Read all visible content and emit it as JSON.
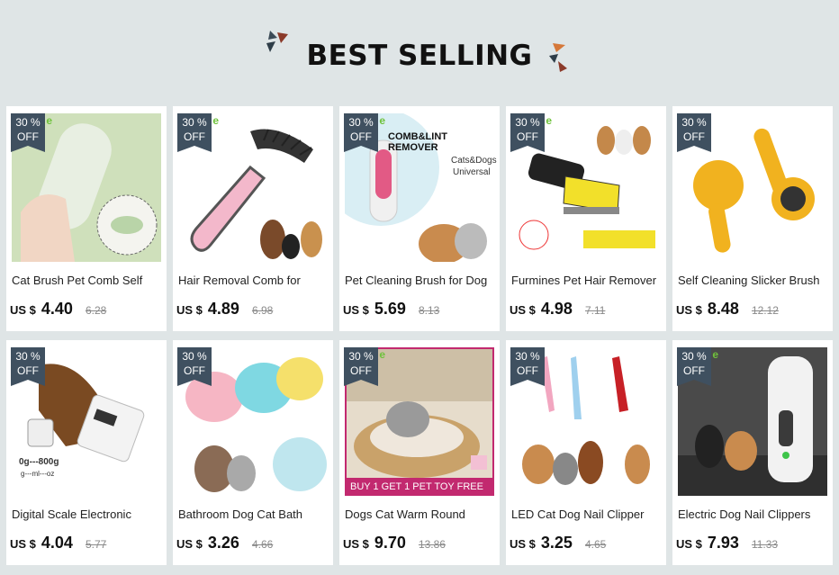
{
  "header": {
    "title": "BEST SELLING"
  },
  "products": [
    {
      "discount": "30 %",
      "off": "OFF",
      "name": "Cat Brush Pet Comb Self",
      "currency": "US $",
      "price": "4.40",
      "old_price": "6.28"
    },
    {
      "discount": "30 %",
      "off": "OFF",
      "name": "Hair Removal Comb for",
      "currency": "US $",
      "price": "4.89",
      "old_price": "6.98"
    },
    {
      "discount": "30 %",
      "off": "OFF",
      "name": "Pet Cleaning Brush for Dog",
      "currency": "US $",
      "price": "5.69",
      "old_price": "8.13",
      "image_text": [
        "COMB&LINT REMOVER",
        "Cats&Dogs",
        "Universal"
      ]
    },
    {
      "discount": "30 %",
      "off": "OFF",
      "name": "Furmines Pet Hair Remover",
      "currency": "US $",
      "price": "4.98",
      "old_price": "7.11"
    },
    {
      "discount": "30 %",
      "off": "OFF",
      "name": "Self Cleaning Slicker Brush",
      "currency": "US $",
      "price": "8.48",
      "old_price": "12.12"
    },
    {
      "discount": "30 %",
      "off": "OFF",
      "name": "Digital Scale Electronic",
      "currency": "US $",
      "price": "4.04",
      "old_price": "5.77",
      "image_text": [
        "0g---800g",
        "g---ml---oz"
      ]
    },
    {
      "discount": "30 %",
      "off": "OFF",
      "name": "Bathroom Dog Cat Bath",
      "currency": "US $",
      "price": "3.26",
      "old_price": "4.66"
    },
    {
      "discount": "30 %",
      "off": "OFF",
      "name": "Dogs Cat Warm Round",
      "currency": "US $",
      "price": "9.70",
      "old_price": "13.86",
      "image_text": [
        "BUY 1 GET 1 PET TOY FREE"
      ]
    },
    {
      "discount": "30 %",
      "off": "OFF",
      "name": "LED Cat Dog Nail Clipper",
      "currency": "US $",
      "price": "3.25",
      "old_price": "4.65"
    },
    {
      "discount": "30 %",
      "off": "OFF",
      "name": "Electric Dog Nail Clippers",
      "currency": "US $",
      "price": "7.93",
      "old_price": "11.33"
    }
  ],
  "colors": {
    "background": "#dfe5e6",
    "badge": "#3f5060",
    "card": "#ffffff",
    "promo": "#c2296f",
    "accent_green": "#6fc23c"
  }
}
